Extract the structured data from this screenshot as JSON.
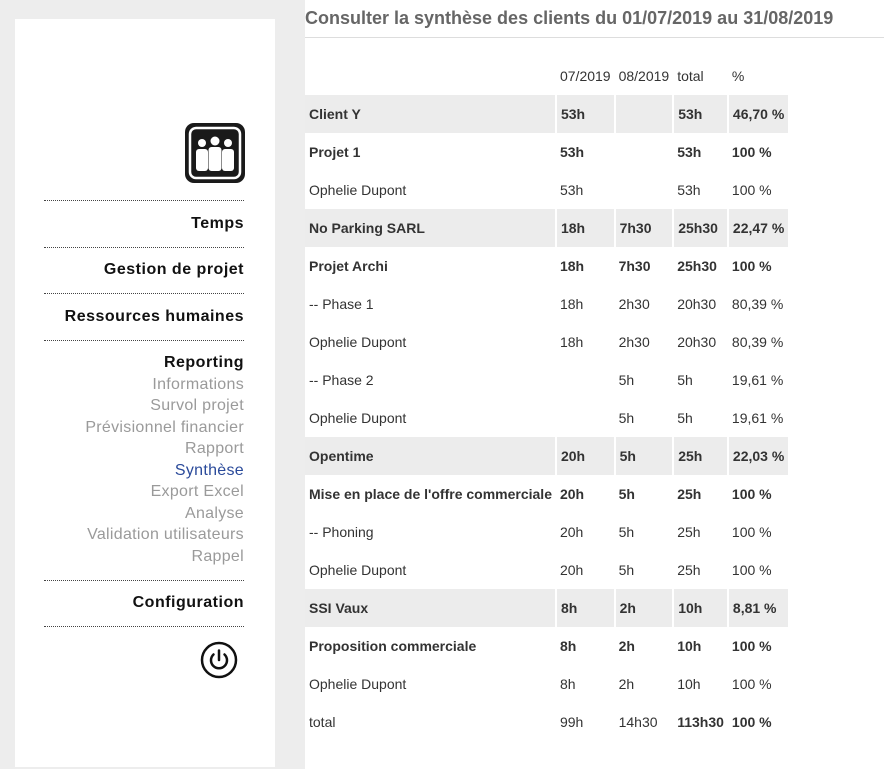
{
  "nav": {
    "sections": [
      {
        "label": "Temps"
      },
      {
        "label": "Gestion de projet"
      },
      {
        "label": "Ressources humaines"
      },
      {
        "label": "Reporting"
      },
      {
        "label": "Configuration"
      }
    ],
    "reporting_items": [
      {
        "label": "Informations",
        "active": false
      },
      {
        "label": "Survol projet",
        "active": false
      },
      {
        "label": "Prévisionnel financier",
        "active": false
      },
      {
        "label": "Rapport",
        "active": false
      },
      {
        "label": "Synthèse",
        "active": true
      },
      {
        "label": "Export Excel",
        "active": false
      },
      {
        "label": "Analyse",
        "active": false
      },
      {
        "label": "Validation utilisateurs",
        "active": false
      },
      {
        "label": "Rappel",
        "active": false
      }
    ],
    "logo_icon": "team-logo-icon",
    "power_icon": "power-icon"
  },
  "main": {
    "title": "Consulter la synthèse des clients du 01/07/2019 au 31/08/2019",
    "columns": [
      "",
      "07/2019",
      "08/2019",
      "total",
      "%"
    ],
    "rows": [
      {
        "cells": [
          "Client Y",
          "53h",
          "",
          "53h",
          "46,70 %"
        ],
        "bold": true,
        "shaded": true
      },
      {
        "cells": [
          "Projet 1",
          "53h",
          "",
          "53h",
          "100 %"
        ],
        "bold": true,
        "shaded": false
      },
      {
        "cells": [
          "Ophelie Dupont",
          "53h",
          "",
          "53h",
          "100 %"
        ],
        "bold": false,
        "shaded": false
      },
      {
        "cells": [
          "No Parking SARL",
          "18h",
          "7h30",
          "25h30",
          "22,47 %"
        ],
        "bold": true,
        "shaded": true
      },
      {
        "cells": [
          "Projet Archi",
          "18h",
          "7h30",
          "25h30",
          "100 %"
        ],
        "bold": true,
        "shaded": false
      },
      {
        "cells": [
          "-- Phase 1",
          "18h",
          "2h30",
          "20h30",
          "80,39 %"
        ],
        "bold": false,
        "shaded": false
      },
      {
        "cells": [
          "Ophelie Dupont",
          "18h",
          "2h30",
          "20h30",
          "80,39 %"
        ],
        "bold": false,
        "shaded": false
      },
      {
        "cells": [
          "-- Phase 2",
          "",
          "5h",
          "5h",
          "19,61 %"
        ],
        "bold": false,
        "shaded": false
      },
      {
        "cells": [
          "Ophelie Dupont",
          "",
          "5h",
          "5h",
          "19,61 %"
        ],
        "bold": false,
        "shaded": false
      },
      {
        "cells": [
          "Opentime",
          "20h",
          "5h",
          "25h",
          "22,03 %"
        ],
        "bold": true,
        "shaded": true
      },
      {
        "cells": [
          "Mise en place de l'offre commerciale",
          "20h",
          "5h",
          "25h",
          "100 %"
        ],
        "bold": true,
        "shaded": false
      },
      {
        "cells": [
          "-- Phoning",
          "20h",
          "5h",
          "25h",
          "100 %"
        ],
        "bold": false,
        "shaded": false
      },
      {
        "cells": [
          "Ophelie Dupont",
          "20h",
          "5h",
          "25h",
          "100 %"
        ],
        "bold": false,
        "shaded": false
      },
      {
        "cells": [
          "SSI Vaux",
          "8h",
          "2h",
          "10h",
          "8,81 %"
        ],
        "bold": true,
        "shaded": true
      },
      {
        "cells": [
          "Proposition commerciale",
          "8h",
          "2h",
          "10h",
          "100 %"
        ],
        "bold": true,
        "shaded": false
      },
      {
        "cells": [
          "Ophelie Dupont",
          "8h",
          "2h",
          "10h",
          "100 %"
        ],
        "bold": false,
        "shaded": false
      },
      {
        "cells": [
          "total",
          "99h",
          "14h30",
          "113h30",
          "100 %"
        ],
        "bold": false,
        "shaded": false,
        "total": true
      }
    ]
  },
  "colors": {
    "active_link": "#2a4a9a",
    "inactive_link": "#9a9a9a",
    "shaded_row": "#ececec",
    "background": "#ededed"
  }
}
